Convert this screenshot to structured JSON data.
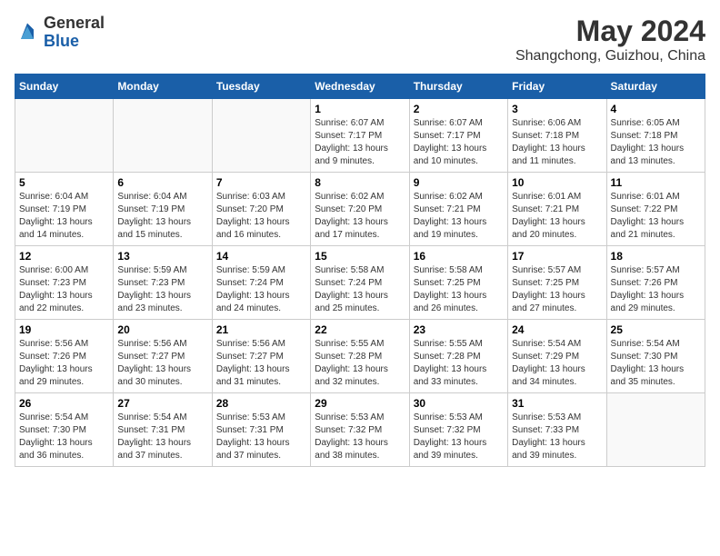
{
  "header": {
    "logo_general": "General",
    "logo_blue": "Blue",
    "month_year": "May 2024",
    "location": "Shangchong, Guizhou, China"
  },
  "days_of_week": [
    "Sunday",
    "Monday",
    "Tuesday",
    "Wednesday",
    "Thursday",
    "Friday",
    "Saturday"
  ],
  "weeks": [
    [
      {
        "day": "",
        "info": ""
      },
      {
        "day": "",
        "info": ""
      },
      {
        "day": "",
        "info": ""
      },
      {
        "day": "1",
        "info": "Sunrise: 6:07 AM\nSunset: 7:17 PM\nDaylight: 13 hours\nand 9 minutes."
      },
      {
        "day": "2",
        "info": "Sunrise: 6:07 AM\nSunset: 7:17 PM\nDaylight: 13 hours\nand 10 minutes."
      },
      {
        "day": "3",
        "info": "Sunrise: 6:06 AM\nSunset: 7:18 PM\nDaylight: 13 hours\nand 11 minutes."
      },
      {
        "day": "4",
        "info": "Sunrise: 6:05 AM\nSunset: 7:18 PM\nDaylight: 13 hours\nand 13 minutes."
      }
    ],
    [
      {
        "day": "5",
        "info": "Sunrise: 6:04 AM\nSunset: 7:19 PM\nDaylight: 13 hours\nand 14 minutes."
      },
      {
        "day": "6",
        "info": "Sunrise: 6:04 AM\nSunset: 7:19 PM\nDaylight: 13 hours\nand 15 minutes."
      },
      {
        "day": "7",
        "info": "Sunrise: 6:03 AM\nSunset: 7:20 PM\nDaylight: 13 hours\nand 16 minutes."
      },
      {
        "day": "8",
        "info": "Sunrise: 6:02 AM\nSunset: 7:20 PM\nDaylight: 13 hours\nand 17 minutes."
      },
      {
        "day": "9",
        "info": "Sunrise: 6:02 AM\nSunset: 7:21 PM\nDaylight: 13 hours\nand 19 minutes."
      },
      {
        "day": "10",
        "info": "Sunrise: 6:01 AM\nSunset: 7:21 PM\nDaylight: 13 hours\nand 20 minutes."
      },
      {
        "day": "11",
        "info": "Sunrise: 6:01 AM\nSunset: 7:22 PM\nDaylight: 13 hours\nand 21 minutes."
      }
    ],
    [
      {
        "day": "12",
        "info": "Sunrise: 6:00 AM\nSunset: 7:23 PM\nDaylight: 13 hours\nand 22 minutes."
      },
      {
        "day": "13",
        "info": "Sunrise: 5:59 AM\nSunset: 7:23 PM\nDaylight: 13 hours\nand 23 minutes."
      },
      {
        "day": "14",
        "info": "Sunrise: 5:59 AM\nSunset: 7:24 PM\nDaylight: 13 hours\nand 24 minutes."
      },
      {
        "day": "15",
        "info": "Sunrise: 5:58 AM\nSunset: 7:24 PM\nDaylight: 13 hours\nand 25 minutes."
      },
      {
        "day": "16",
        "info": "Sunrise: 5:58 AM\nSunset: 7:25 PM\nDaylight: 13 hours\nand 26 minutes."
      },
      {
        "day": "17",
        "info": "Sunrise: 5:57 AM\nSunset: 7:25 PM\nDaylight: 13 hours\nand 27 minutes."
      },
      {
        "day": "18",
        "info": "Sunrise: 5:57 AM\nSunset: 7:26 PM\nDaylight: 13 hours\nand 29 minutes."
      }
    ],
    [
      {
        "day": "19",
        "info": "Sunrise: 5:56 AM\nSunset: 7:26 PM\nDaylight: 13 hours\nand 29 minutes."
      },
      {
        "day": "20",
        "info": "Sunrise: 5:56 AM\nSunset: 7:27 PM\nDaylight: 13 hours\nand 30 minutes."
      },
      {
        "day": "21",
        "info": "Sunrise: 5:56 AM\nSunset: 7:27 PM\nDaylight: 13 hours\nand 31 minutes."
      },
      {
        "day": "22",
        "info": "Sunrise: 5:55 AM\nSunset: 7:28 PM\nDaylight: 13 hours\nand 32 minutes."
      },
      {
        "day": "23",
        "info": "Sunrise: 5:55 AM\nSunset: 7:28 PM\nDaylight: 13 hours\nand 33 minutes."
      },
      {
        "day": "24",
        "info": "Sunrise: 5:54 AM\nSunset: 7:29 PM\nDaylight: 13 hours\nand 34 minutes."
      },
      {
        "day": "25",
        "info": "Sunrise: 5:54 AM\nSunset: 7:30 PM\nDaylight: 13 hours\nand 35 minutes."
      }
    ],
    [
      {
        "day": "26",
        "info": "Sunrise: 5:54 AM\nSunset: 7:30 PM\nDaylight: 13 hours\nand 36 minutes."
      },
      {
        "day": "27",
        "info": "Sunrise: 5:54 AM\nSunset: 7:31 PM\nDaylight: 13 hours\nand 37 minutes."
      },
      {
        "day": "28",
        "info": "Sunrise: 5:53 AM\nSunset: 7:31 PM\nDaylight: 13 hours\nand 37 minutes."
      },
      {
        "day": "29",
        "info": "Sunrise: 5:53 AM\nSunset: 7:32 PM\nDaylight: 13 hours\nand 38 minutes."
      },
      {
        "day": "30",
        "info": "Sunrise: 5:53 AM\nSunset: 7:32 PM\nDaylight: 13 hours\nand 39 minutes."
      },
      {
        "day": "31",
        "info": "Sunrise: 5:53 AM\nSunset: 7:33 PM\nDaylight: 13 hours\nand 39 minutes."
      },
      {
        "day": "",
        "info": ""
      }
    ]
  ]
}
